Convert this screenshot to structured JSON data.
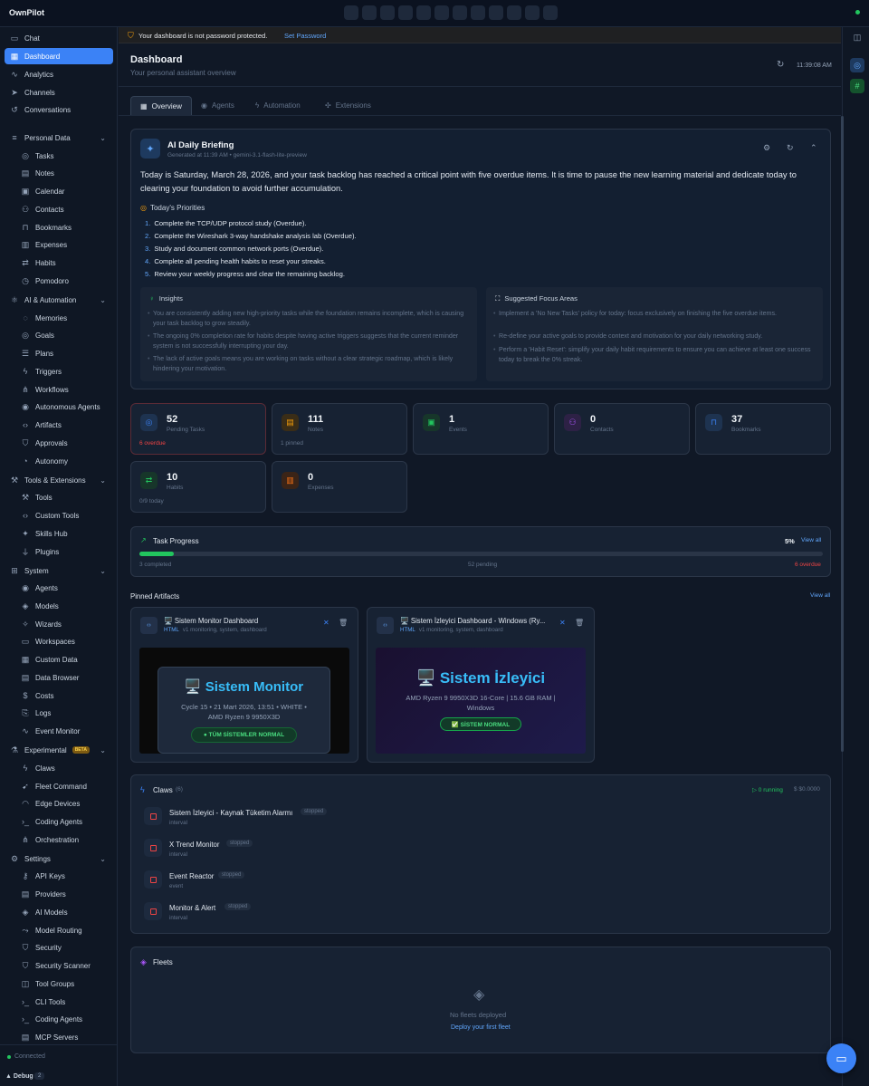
{
  "app": {
    "name": "OwnPilot"
  },
  "banner": {
    "text": "Your dashboard is not password protected.",
    "link": "Set Password"
  },
  "header": {
    "title": "Dashboard",
    "subtitle": "Your personal assistant overview",
    "time": "11:39:08 AM"
  },
  "tabs": [
    "Overview",
    "Agents",
    "Automation",
    "Extensions"
  ],
  "sidebar": {
    "top": [
      "Chat",
      "Dashboard",
      "Analytics",
      "Channels",
      "Conversations"
    ],
    "personal_data": {
      "label": "Personal Data",
      "items": [
        "Tasks",
        "Notes",
        "Calendar",
        "Contacts",
        "Bookmarks",
        "Expenses",
        "Habits",
        "Pomodoro"
      ]
    },
    "ai_automation": {
      "label": "AI & Automation",
      "items": [
        "Memories",
        "Goals",
        "Plans",
        "Triggers",
        "Workflows",
        "Autonomous Agents",
        "Artifacts",
        "Approvals",
        "Autonomy"
      ]
    },
    "tools_extensions": {
      "label": "Tools & Extensions",
      "items": [
        "Tools",
        "Custom Tools",
        "Skills Hub",
        "Plugins"
      ]
    },
    "system": {
      "label": "System",
      "items": [
        "Agents",
        "Models",
        "Wizards",
        "Workspaces",
        "Custom Data",
        "Data Browser",
        "Costs",
        "Logs",
        "Event Monitor"
      ]
    },
    "experimental": {
      "label": "Experimental",
      "badge": "BETA",
      "items": [
        "Claws",
        "Fleet Command",
        "Edge Devices",
        "Coding Agents",
        "Orchestration"
      ]
    },
    "settings": {
      "label": "Settings",
      "items": [
        "API Keys",
        "Providers",
        "AI Models",
        "Model Routing",
        "Security",
        "Security Scanner",
        "Tool Groups",
        "CLI Tools",
        "Coding Agents",
        "MCP Servers"
      ]
    },
    "status": "Connected",
    "debug": {
      "label": "Debug",
      "count": "2"
    }
  },
  "briefing": {
    "title": "AI Daily Briefing",
    "generated": "Generated at 11:39 AM • gemini-3.1-flash-lite-preview",
    "summary": "Today is Saturday, March 28, 2026, and your task backlog has reached a critical point with five overdue items. It is time to pause the new learning material and dedicate today to clearing your foundation to avoid further accumulation.",
    "priorities_label": "Today's Priorities",
    "priorities": [
      {
        "n": "1.",
        "text": "Complete the TCP/UDP protocol study (Overdue)."
      },
      {
        "n": "2.",
        "text": "Complete the Wireshark 3-way handshake analysis lab (Overdue)."
      },
      {
        "n": "3.",
        "text": "Study and document common network ports (Overdue)."
      },
      {
        "n": "4.",
        "text": "Complete all pending health habits to reset your streaks."
      },
      {
        "n": "5.",
        "text": "Review your weekly progress and clear the remaining backlog."
      }
    ],
    "insights_label": "Insights",
    "insights": [
      "You are consistently adding new high-priority tasks while the foundation remains incomplete, which is causing your task backlog to grow steadily.",
      "The ongoing 0% completion rate for habits despite having active triggers suggests that the current reminder system is not successfully interrupting your day.",
      "The lack of active goals means you are working on tasks without a clear strategic roadmap, which is likely hindering your motivation."
    ],
    "focus_label": "Suggested Focus Areas",
    "focus": [
      "Implement a 'No New Tasks' policy for today: focus exclusively on finishing the five overdue items.",
      "Re-define your active goals to provide context and motivation for your daily networking study.",
      "Perform a 'Habit Reset': simplify your daily habit requirements to ensure you can achieve at least one success today to break the 0% streak."
    ]
  },
  "stats": [
    {
      "value": "52",
      "label": "Pending Tasks",
      "foot": "6 overdue",
      "icon": "check-circle-icon",
      "color": "#3b82f6"
    },
    {
      "value": "111",
      "label": "Notes",
      "foot": "1 pinned",
      "icon": "note-icon",
      "color": "#f59e0b"
    },
    {
      "value": "1",
      "label": "Events",
      "foot": "",
      "icon": "calendar-icon",
      "color": "#22c55e"
    },
    {
      "value": "0",
      "label": "Contacts",
      "foot": "",
      "icon": "users-icon",
      "color": "#a855f7"
    },
    {
      "value": "37",
      "label": "Bookmarks",
      "foot": "",
      "icon": "bookmark-icon",
      "color": "#3b82f6"
    },
    {
      "value": "10",
      "label": "Habits",
      "foot": "0/9 today",
      "icon": "repeat-icon",
      "color": "#22c55e"
    },
    {
      "value": "0",
      "label": "Expenses",
      "foot": "",
      "icon": "receipt-icon",
      "color": "#f97316"
    }
  ],
  "task_progress": {
    "title": "Task Progress",
    "percent": "5%",
    "fraction": 0.05,
    "view_all": "View all",
    "completed": "3 completed",
    "pending": "52 pending",
    "overdue": "6 overdue"
  },
  "pinned": {
    "title": "Pinned Artifacts",
    "view_all": "View all",
    "items": [
      {
        "title": "🖥️ Sistem Monitor Dashboard",
        "type": "HTML",
        "version": "v1",
        "tags": "monitoring, system, dashboard",
        "preview_title": "🖥️ Sistem Monitor",
        "preview_sub": "Cycle 15 • 21 Mart 2026, 13:51 • WHITE • AMD Ryzen 9 9950X3D",
        "preview_badge": "● TÜM SİSTEMLER NORMAL"
      },
      {
        "title": "🖥️ Sistem İzleyici Dashboard - Windows (Ry...",
        "type": "HTML",
        "version": "v1",
        "tags": "monitoring, system, dashboard",
        "preview_title": "🖥️ Sistem İzleyici",
        "preview_sub": "AMD Ryzen 9 9950X3D 16-Core | 15.6 GB RAM | Windows",
        "preview_badge": "✅ SİSTEM NORMAL"
      }
    ]
  },
  "claws": {
    "title": "Claws",
    "count": "(6)",
    "running": "▷ 0 running",
    "cost": "$ $0.0000",
    "items": [
      {
        "name": "Sistem İzleyici - Kaynak Tüketim Alarmı",
        "status": "stopped",
        "type": "interval"
      },
      {
        "name": "X Trend Monitor",
        "status": "stopped",
        "type": "interval"
      },
      {
        "name": "Event Reactor",
        "status": "stopped",
        "type": "event"
      },
      {
        "name": "Monitor & Alert",
        "status": "stopped",
        "type": "interval"
      }
    ]
  },
  "fleets": {
    "title": "Fleets",
    "empty": "No fleets deployed",
    "link": "Deploy your first fleet"
  },
  "colors": {
    "accent": "#3b82f6",
    "success": "#22c55e",
    "danger": "#ef4444",
    "warning": "#f59e0b"
  }
}
